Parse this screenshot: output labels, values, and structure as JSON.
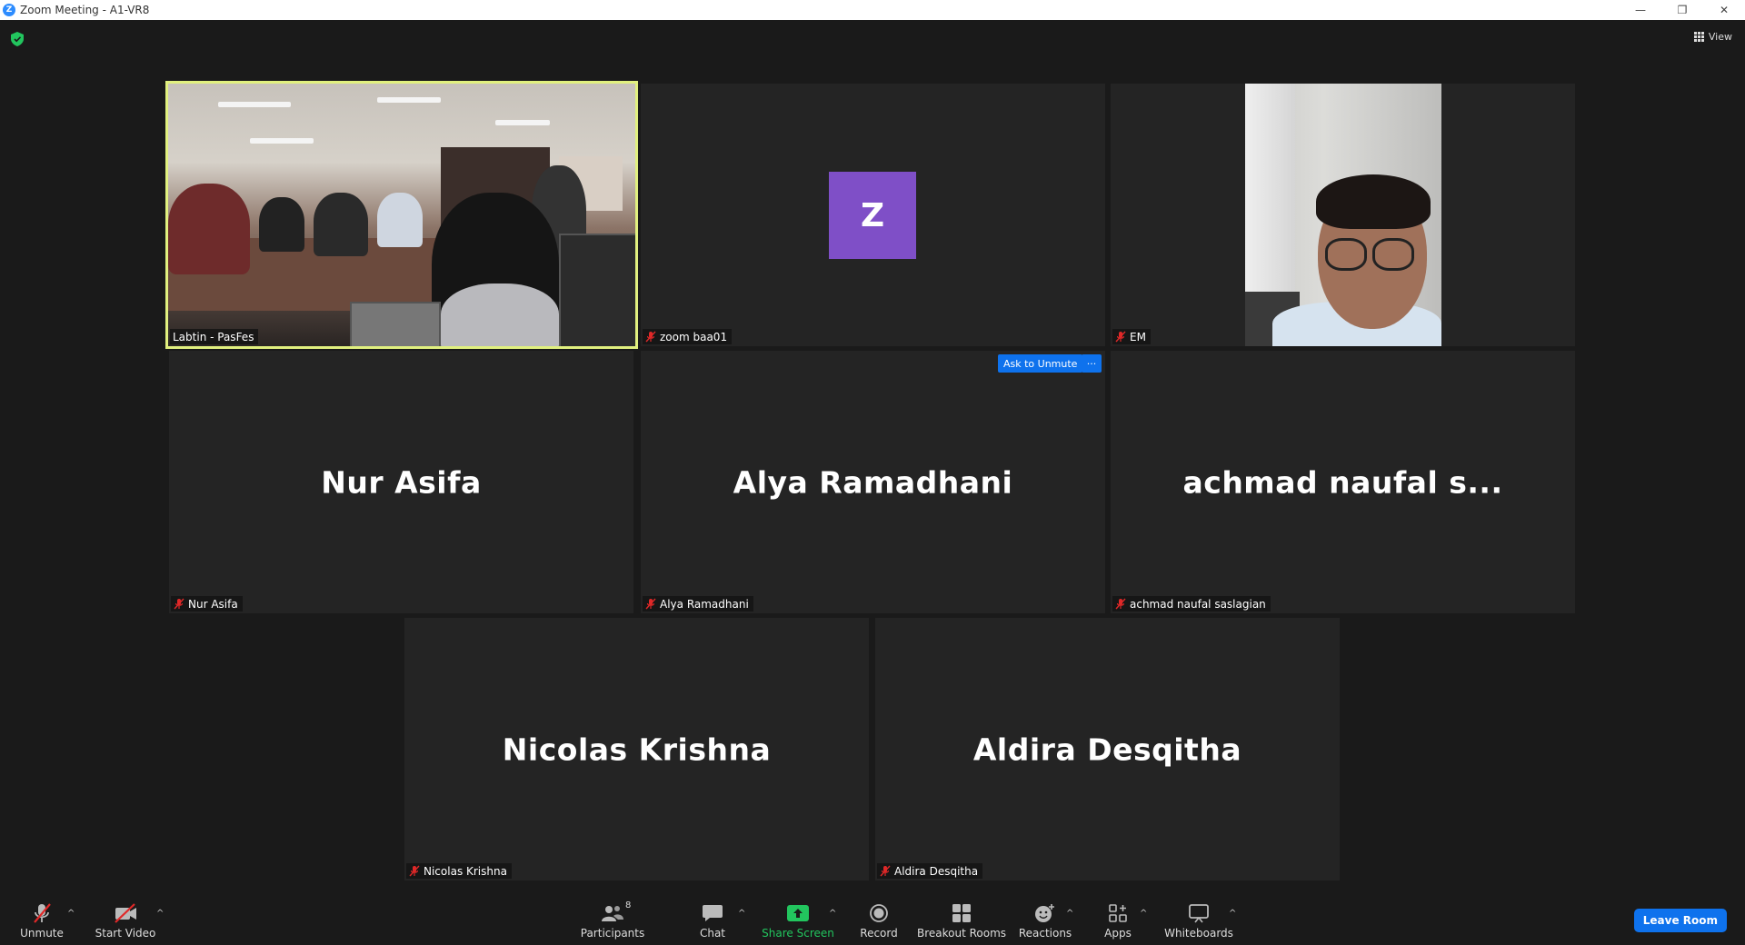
{
  "window": {
    "title": "Zoom Meeting - A1-VR8",
    "app_icon_letter": "Z",
    "minimize": "—",
    "restore": "❐",
    "close": "✕"
  },
  "header": {
    "view_label": "View"
  },
  "tiles": [
    {
      "id": "labtin",
      "name_tag": "Labtin - PasFes",
      "video": true,
      "active_speaker": true,
      "muted": false
    },
    {
      "id": "zoom-baa01",
      "name_tag": "zoom baa01",
      "avatar_letter": "Z",
      "avatar_color": "#7f4fc7",
      "muted": true
    },
    {
      "id": "em",
      "name_tag": "EM",
      "video": true,
      "muted": true
    },
    {
      "id": "nur-asifa",
      "display_name": "Nur Asifa",
      "name_tag": "Nur Asifa",
      "muted": true
    },
    {
      "id": "alya",
      "display_name": "Alya Ramadhani",
      "name_tag": "Alya Ramadhani",
      "muted": true,
      "hover_actions": {
        "ask_to_unmute": "Ask to Unmute",
        "more": "···"
      }
    },
    {
      "id": "achmad",
      "display_name": "achmad naufal s...",
      "name_tag": "achmad naufal saslagian",
      "muted": true
    },
    {
      "id": "nicolas",
      "display_name": "Nicolas Krishna",
      "name_tag": "Nicolas Krishna",
      "muted": true
    },
    {
      "id": "aldira",
      "display_name": "Aldira Desqitha",
      "name_tag": "Aldira Desqitha",
      "muted": true
    }
  ],
  "toolbar": {
    "unmute": "Unmute",
    "start_video": "Start Video",
    "participants": "Participants",
    "participants_count": "8",
    "chat": "Chat",
    "share_screen": "Share Screen",
    "record": "Record",
    "breakout_rooms": "Breakout Rooms",
    "reactions": "Reactions",
    "apps": "Apps",
    "whiteboards": "Whiteboards",
    "leave": "Leave Room",
    "caret": "^"
  },
  "colors": {
    "background": "#1a1a1a",
    "tile": "#242424",
    "active_border": "#e1f07f",
    "accent_blue": "#0e72ed",
    "share_green": "#22c55e",
    "muted_red": "#e02828"
  }
}
